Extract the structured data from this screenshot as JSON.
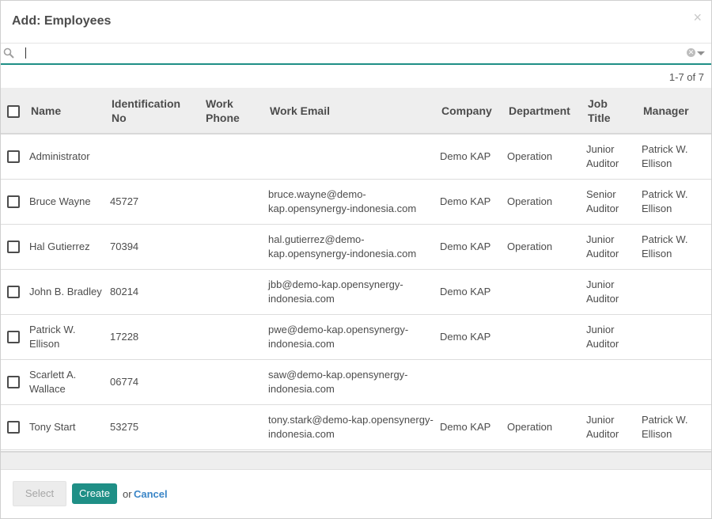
{
  "dialog": {
    "title": "Add: Employees"
  },
  "search": {
    "value": "",
    "placeholder": ""
  },
  "pager": {
    "text": "1-7 of 7"
  },
  "table": {
    "headers": {
      "name": "Name",
      "id_no_1": "Identification",
      "id_no_2": "No",
      "work_phone_1": "Work",
      "work_phone_2": "Phone",
      "work_email": "Work Email",
      "company": "Company",
      "department": "Department",
      "job_title_1": "Job",
      "job_title_2": "Title",
      "manager": "Manager"
    },
    "rows": [
      {
        "name_1": "Administrator",
        "name_2": "",
        "id_no": "",
        "work_phone": "",
        "email_1": "",
        "email_2": "",
        "company": "Demo KAP",
        "department": "Operation",
        "job_1": "Junior",
        "job_2": "Auditor",
        "manager_1": "Patrick W.",
        "manager_2": "Ellison"
      },
      {
        "name_1": "Bruce Wayne",
        "name_2": "",
        "id_no": "45727",
        "work_phone": "",
        "email_1": "bruce.wayne@demo-",
        "email_2": "kap.opensynergy-indonesia.com",
        "company": "Demo KAP",
        "department": "Operation",
        "job_1": "Senior",
        "job_2": "Auditor",
        "manager_1": "Patrick W.",
        "manager_2": "Ellison"
      },
      {
        "name_1": "Hal Gutierrez",
        "name_2": "",
        "id_no": "70394",
        "work_phone": "",
        "email_1": "hal.gutierrez@demo-",
        "email_2": "kap.opensynergy-indonesia.com",
        "company": "Demo KAP",
        "department": "Operation",
        "job_1": "Junior",
        "job_2": "Auditor",
        "manager_1": "Patrick W.",
        "manager_2": "Ellison"
      },
      {
        "name_1": "John B. Bradley",
        "name_2": "",
        "id_no": "80214",
        "work_phone": "",
        "email_1": "jbb@demo-kap.opensynergy-",
        "email_2": "indonesia.com",
        "company": "Demo KAP",
        "department": "",
        "job_1": "Junior",
        "job_2": "Auditor",
        "manager_1": "",
        "manager_2": ""
      },
      {
        "name_1": "Patrick W.",
        "name_2": "Ellison",
        "id_no": "17228",
        "work_phone": "",
        "email_1": "pwe@demo-kap.opensynergy-",
        "email_2": "indonesia.com",
        "company": "Demo KAP",
        "department": "",
        "job_1": "Junior",
        "job_2": "Auditor",
        "manager_1": "",
        "manager_2": ""
      },
      {
        "name_1": "Scarlett A.",
        "name_2": "Wallace",
        "id_no": "06774",
        "work_phone": "",
        "email_1": "saw@demo-kap.opensynergy-",
        "email_2": "indonesia.com",
        "company": "",
        "department": "",
        "job_1": "",
        "job_2": "",
        "manager_1": "",
        "manager_2": ""
      },
      {
        "name_1": "Tony Start",
        "name_2": "",
        "id_no": "53275",
        "work_phone": "",
        "email_1": "tony.stark@demo-kap.opensynergy-",
        "email_2": "indonesia.com",
        "company": "Demo KAP",
        "department": "Operation",
        "job_1": "Junior",
        "job_2": "Auditor",
        "manager_1": "Patrick W.",
        "manager_2": "Ellison"
      }
    ]
  },
  "footer": {
    "select_label": "Select",
    "create_label": "Create",
    "or_text": "or",
    "cancel_label": "Cancel"
  },
  "colors": {
    "accent": "#1f8f86",
    "link": "#3b86c7"
  }
}
